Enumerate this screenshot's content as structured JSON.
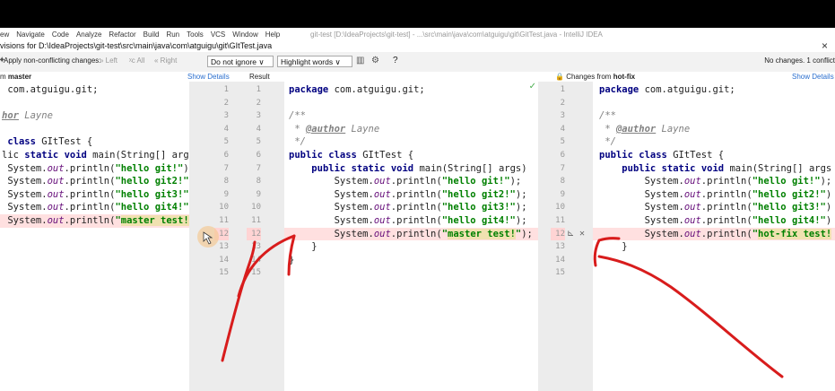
{
  "menubar": {
    "items": [
      "ew",
      "Navigate",
      "Code",
      "Analyze",
      "Refactor",
      "Build",
      "Run",
      "Tools",
      "VCS",
      "Window",
      "Help"
    ],
    "path_text": "git-test [D:\\IdeaProjects\\git-test] - ...\\src\\main\\java\\com\\atguigu\\git\\GitTest.java - IntelliJ IDEA"
  },
  "title": {
    "text": "visions for D:\\IdeaProjects\\git-test\\src\\main\\java\\com\\atguigu\\git\\GItTest.java",
    "close": "×"
  },
  "toolbar": {
    "apply_label": "Apply non-conflicting changes:",
    "left": "» Left",
    "all": "ᵡc All",
    "right": "« Right",
    "whitespace_select": "Do not ignore ∨",
    "highlight_select": "Highlight words ∨",
    "help": "?",
    "status": "No changes. 1 conflict"
  },
  "headers": {
    "left_prefix": "m",
    "left_branch": "master",
    "show_details_left": "Show Details",
    "result": "Result",
    "right_prefix": "Changes from",
    "right_branch": "hot-fix",
    "show_details_right": "Show Details"
  },
  "left_code": [
    " com.atguigu.git;",
    "",
    "hor Layne",
    "",
    " class GItTest {",
    "lic static void main(String[] args",
    " System.out.println(\"hello git!\")",
    " System.out.println(\"hello git2!\"",
    " System.out.println(\"hello git3!\"",
    " System.out.println(\"hello git4!\"",
    " System.out.println(\"master test!"
  ],
  "center_code": [
    "package com.atguigu.git;",
    "",
    "/**",
    " * @author Layne",
    " */",
    "public class GItTest {",
    "    public static void main(String[] args)",
    "        System.out.println(\"hello git!\");",
    "        System.out.println(\"hello git2!\");",
    "        System.out.println(\"hello git3!\");",
    "        System.out.println(\"hello git4!\");",
    "        System.out.println(\"master test!\");",
    "    }",
    "}"
  ],
  "right_code": [
    "package com.atguigu.git;",
    "",
    "/**",
    " * @author Layne",
    " */",
    "public class GItTest {",
    "    public static void main(String[] args",
    "        System.out.println(\"hello git!\");",
    "        System.out.println(\"hello git2!\")",
    "        System.out.println(\"hello git3!\")",
    "        System.out.println(\"hello git4!\")",
    "        System.out.println(\"hot-fix test!",
    "    }"
  ],
  "gutter_left_numbers": [
    "1",
    "2",
    "3",
    "4",
    "5",
    "6",
    "7",
    "8",
    "9",
    "10",
    "11",
    "12",
    "13",
    "14",
    "15"
  ],
  "gutter_result_numbers": [
    "1",
    "2",
    "3",
    "4",
    "5",
    "6",
    "7",
    "8",
    "9",
    "10",
    "11",
    "12",
    "13",
    "14",
    "15"
  ],
  "gutter_right_numbers": [
    "1",
    "2",
    "3",
    "4",
    "5",
    "6",
    "7",
    "8",
    "9",
    "10",
    "11",
    "12",
    "13",
    "14",
    "15"
  ],
  "conflict_actions": {
    "accept": "⊾",
    "ignore": "✕"
  },
  "checkmark": "✓",
  "colors": {
    "conflict": "#ffe0e0",
    "annotation": "#d81c1c",
    "link": "#2a6fcf"
  }
}
